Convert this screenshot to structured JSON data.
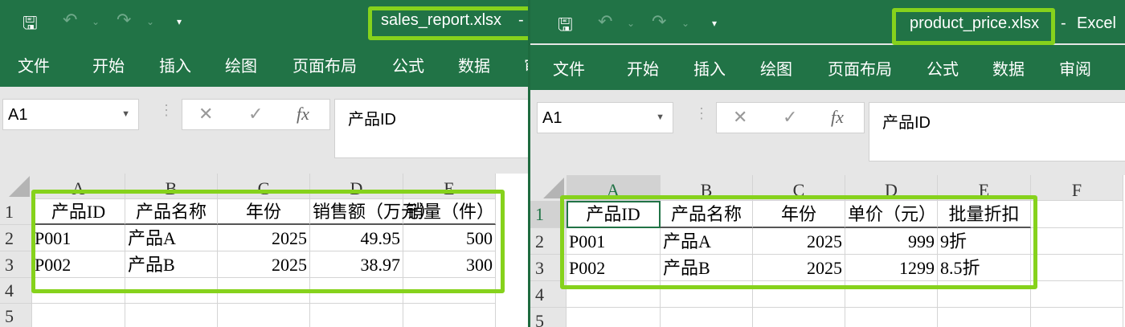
{
  "app_name": "Excel",
  "ribbon_tabs": [
    "文件",
    "开始",
    "插入",
    "绘图",
    "页面布局",
    "公式",
    "数据",
    "审阅"
  ],
  "quick_access": {
    "save": "save-icon",
    "undo": "undo-icon",
    "redo": "redo-icon",
    "customize": "customize-icon"
  },
  "highlight_color": "#86d21c",
  "accent_color": "#217346",
  "windows": [
    {
      "filename": "sales_report.xlsx",
      "separator": "-",
      "name_box": "A1",
      "formula": "产品ID",
      "columns": [
        "A",
        "B",
        "C",
        "D",
        "E"
      ],
      "row_numbers": [
        "1",
        "2",
        "3",
        "4",
        "5"
      ],
      "rows": [
        [
          "产品ID",
          "产品名称",
          "年份",
          "销售额（万元）",
          "销量（件）"
        ],
        [
          "P001",
          "产品A",
          "2025",
          "49.95",
          "500"
        ],
        [
          "P002",
          "产品B",
          "2025",
          "38.97",
          "300"
        ]
      ]
    },
    {
      "filename": "product_price.xlsx",
      "separator": "-",
      "app_suffix": "Excel",
      "name_box": "A1",
      "formula": "产品ID",
      "columns": [
        "A",
        "B",
        "C",
        "D",
        "E",
        "F"
      ],
      "row_numbers": [
        "1",
        "2",
        "3",
        "4",
        "5"
      ],
      "rows": [
        [
          "产品ID",
          "产品名称",
          "年份",
          "单价（元）",
          "批量折扣"
        ],
        [
          "P001",
          "产品A",
          "2025",
          "999",
          "9折"
        ],
        [
          "P002",
          "产品B",
          "2025",
          "1299",
          "8.5折"
        ]
      ]
    }
  ]
}
